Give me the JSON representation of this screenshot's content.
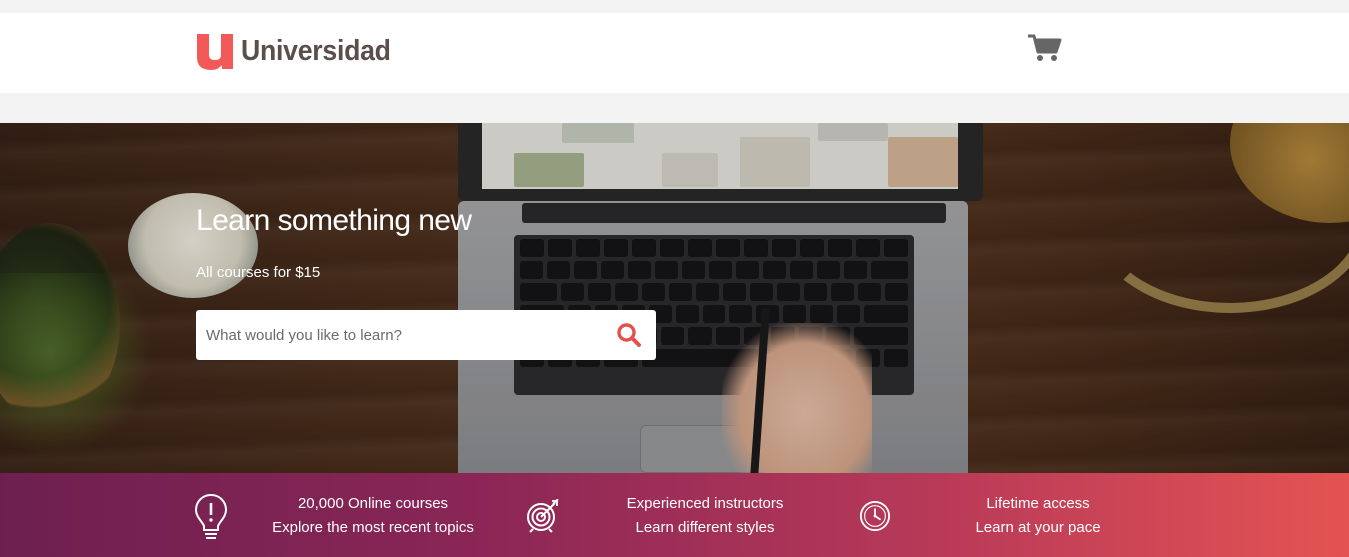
{
  "brand": {
    "name": "Universidad",
    "mark_letter": "u",
    "mark_color": "#f4595a",
    "text_color": "#5a4f4b"
  },
  "header": {
    "cart_icon": "shopping-cart-icon"
  },
  "hero": {
    "title": "Learn something new",
    "subtitle": "All courses for $15",
    "search": {
      "placeholder": "What would you like to learn?",
      "value": "",
      "icon": "search-icon",
      "icon_color": "#e4524f"
    }
  },
  "features": [
    {
      "icon": "lightbulb-icon",
      "line1": "20,000 Online courses",
      "line2": "Explore the most recent topics"
    },
    {
      "icon": "target-icon",
      "line1": "Experienced instructors",
      "line2": "Learn different styles"
    },
    {
      "icon": "clock-icon",
      "line1": "Lifetime access",
      "line2": "Learn at your pace"
    }
  ],
  "colors": {
    "band_start": "#6d2050",
    "band_end": "#e45352",
    "page_bg": "#f4f3f3"
  }
}
